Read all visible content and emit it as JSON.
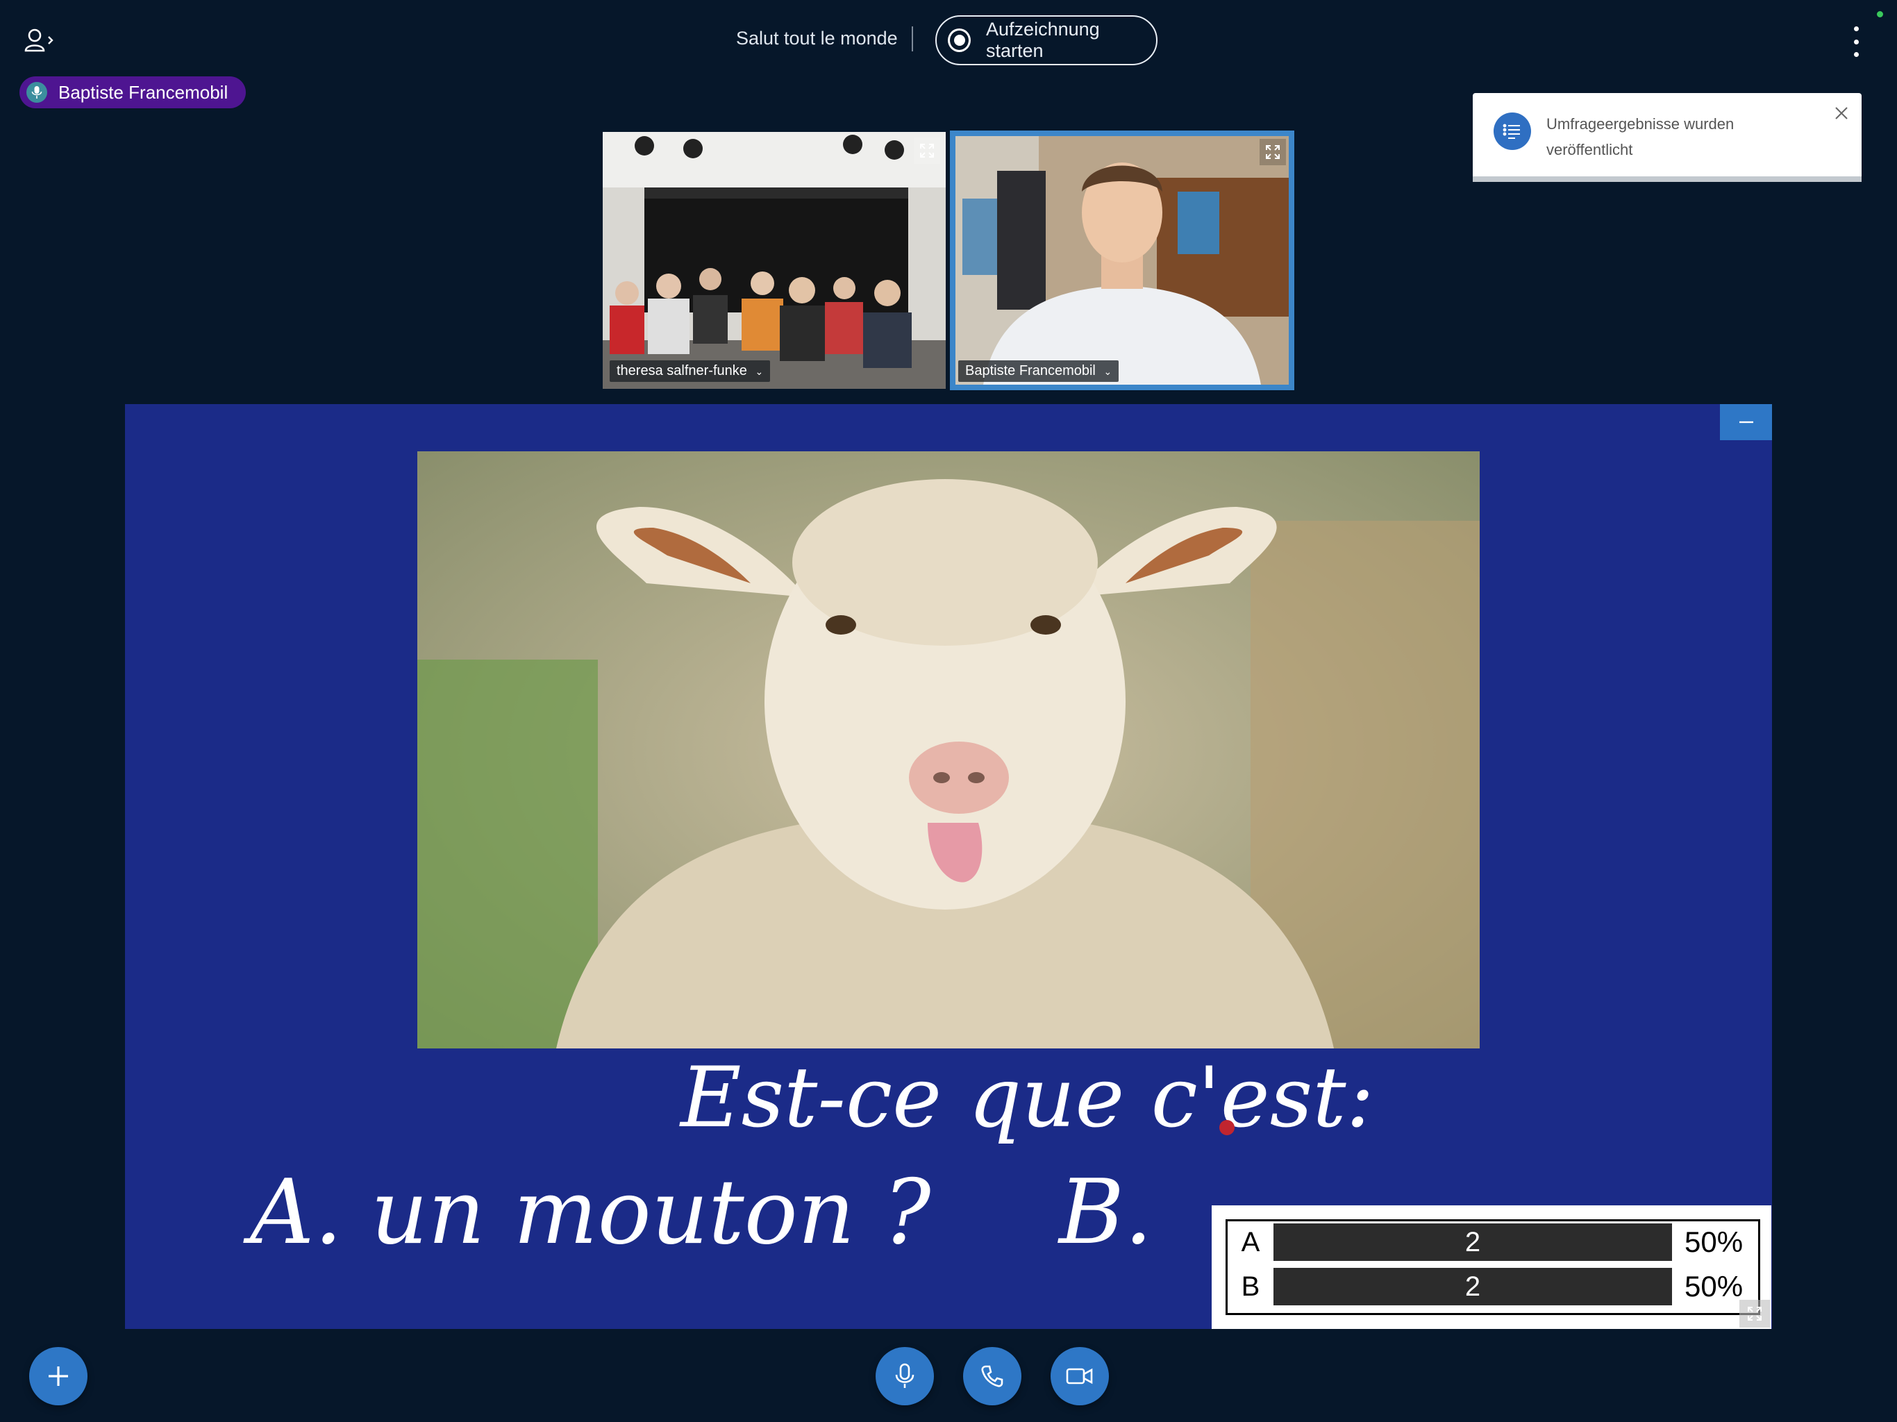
{
  "header": {
    "meeting_title": "Salut tout le monde",
    "record_button_label": "Aufzeichnung starten"
  },
  "talking_indicator": {
    "name": "Baptiste Francemobil",
    "color": "#4e1591"
  },
  "webcams": [
    {
      "name": "theresa salfner-funke"
    },
    {
      "name": "Baptiste Francemobil",
      "active_speaker": true
    }
  ],
  "toast": {
    "message": "Umfrageergebnisse wurden veröffentlicht"
  },
  "presentation": {
    "question": "Est-ce que c'est:",
    "option_a": "A. un mouton ?",
    "option_b": "B."
  },
  "poll_results": [
    {
      "key": "A",
      "votes": "2",
      "percent": "50%"
    },
    {
      "key": "B",
      "votes": "2",
      "percent": "50%"
    }
  ],
  "colors": {
    "background": "#06172a",
    "accent": "#2e77c6",
    "slide_background": "#1b2b88"
  }
}
